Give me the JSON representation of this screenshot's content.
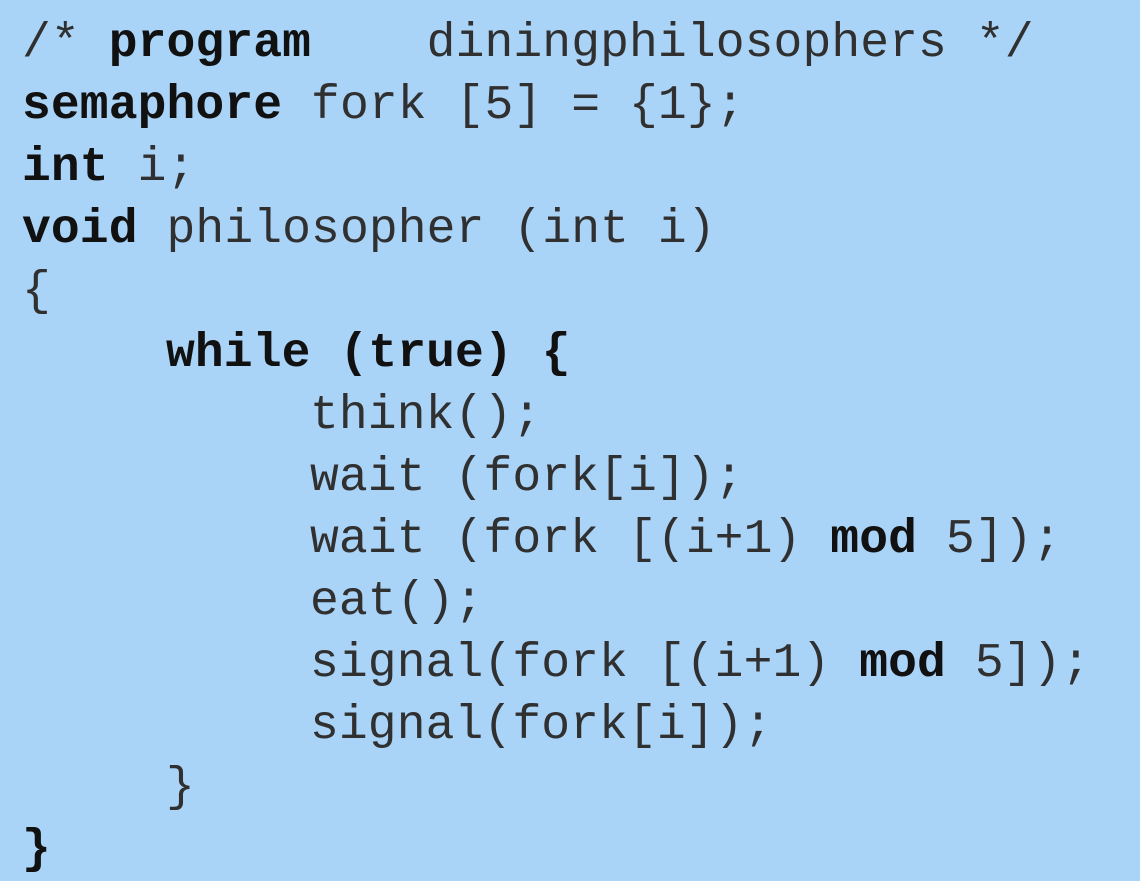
{
  "code": {
    "background_color": "#a9d3f7",
    "lines": [
      {
        "id": "comment-program",
        "segments": [
          {
            "text": "/* ",
            "bold": false
          },
          {
            "text": "program",
            "bold": true
          },
          {
            "text": "    diningphilosophers */",
            "bold": false
          }
        ]
      },
      {
        "id": "semaphore-decl",
        "segments": [
          {
            "text": "semaphore",
            "bold": true
          },
          {
            "text": " fork [5] = {1};",
            "bold": false
          }
        ]
      },
      {
        "id": "int-decl",
        "segments": [
          {
            "text": "int",
            "bold": true
          },
          {
            "text": " i;",
            "bold": false
          }
        ]
      },
      {
        "id": "function-signature",
        "segments": [
          {
            "text": "void",
            "bold": true
          },
          {
            "text": " philosopher (int i)",
            "bold": false
          }
        ]
      },
      {
        "id": "function-open-brace",
        "segments": [
          {
            "text": "{",
            "bold": false
          }
        ]
      },
      {
        "id": "while-loop",
        "indent": 1,
        "segments": [
          {
            "text": "while",
            "bold": true
          },
          {
            "text": " ",
            "bold": false
          },
          {
            "text": "(true) {",
            "bold": true
          }
        ]
      },
      {
        "id": "think-call",
        "indent": 2,
        "segments": [
          {
            "text": "think();",
            "bold": false
          }
        ]
      },
      {
        "id": "wait-left-fork",
        "indent": 2,
        "segments": [
          {
            "text": "wait (fork[i]);",
            "bold": false
          }
        ]
      },
      {
        "id": "wait-right-fork",
        "indent": 2,
        "segments": [
          {
            "text": "wait (fork [(i+1) ",
            "bold": false
          },
          {
            "text": "mod",
            "bold": true
          },
          {
            "text": " 5]);",
            "bold": false
          }
        ]
      },
      {
        "id": "eat-call",
        "indent": 2,
        "segments": [
          {
            "text": "eat();",
            "bold": false
          }
        ]
      },
      {
        "id": "signal-right-fork",
        "indent": 2,
        "segments": [
          {
            "text": "signal(fork [(i+1) ",
            "bold": false
          },
          {
            "text": "mod",
            "bold": true
          },
          {
            "text": " 5]);",
            "bold": false
          }
        ]
      },
      {
        "id": "signal-left-fork",
        "indent": 2,
        "segments": [
          {
            "text": "signal(fork[i]);",
            "bold": false
          }
        ]
      },
      {
        "id": "while-close-brace",
        "indent": 1,
        "segments": [
          {
            "text": "}",
            "bold": false
          }
        ]
      },
      {
        "id": "function-close-brace",
        "segments": [
          {
            "text": "}",
            "bold": true
          }
        ]
      }
    ]
  }
}
